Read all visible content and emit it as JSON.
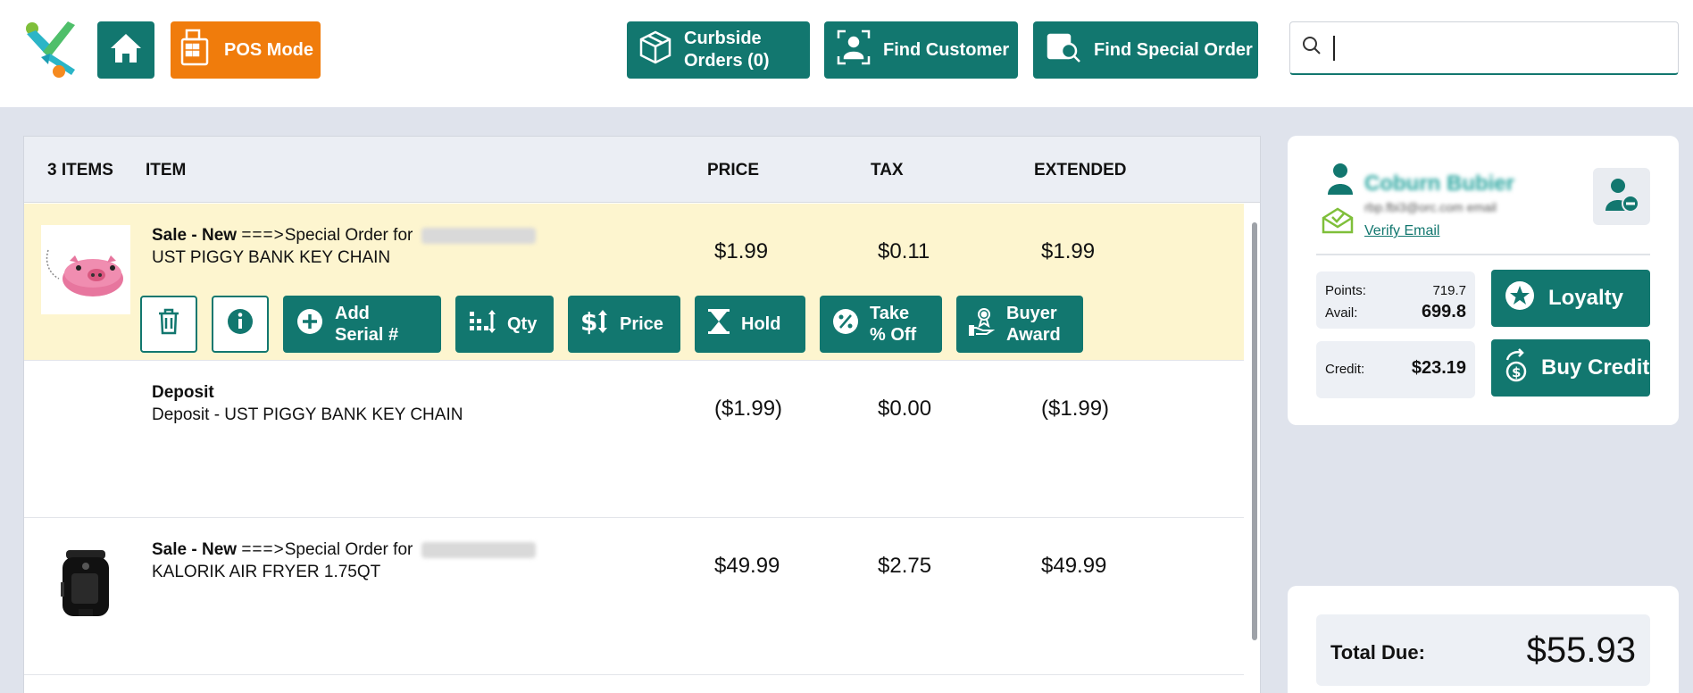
{
  "topbar": {
    "pos_mode_label": "POS Mode",
    "curbside_label_line1": "Curbside",
    "curbside_label_line2": "Orders (0)",
    "find_customer_label": "Find Customer",
    "find_special_order_label": "Find Special Order",
    "search": {
      "value": "",
      "placeholder": ""
    }
  },
  "colors": {
    "accent": "#12776f",
    "pos_orange": "#f07c0c",
    "selected_row": "#fdf5cf"
  },
  "cart": {
    "headers": {
      "count": "3 ITEMS",
      "item": "ITEM",
      "price": "PRICE",
      "tax": "TAX",
      "extended": "EXTENDED"
    },
    "rows": [
      {
        "type_label": "Sale - New",
        "arrow": "===>",
        "special_text": "Special Order for",
        "name": "UST PIGGY BANK KEY CHAIN",
        "price": "$1.99",
        "tax": "$0.11",
        "extended": "$1.99",
        "image": "piggy-bank-keychain"
      },
      {
        "type_label": "Deposit",
        "name": "Deposit - UST PIGGY BANK KEY CHAIN",
        "price": "($1.99)",
        "tax": "$0.00",
        "extended": "($1.99)"
      },
      {
        "type_label": "Sale - New",
        "arrow": "===>",
        "special_text": "Special Order for",
        "name": "KALORIK AIR FRYER 1.75QT",
        "price": "$49.99",
        "tax": "$2.75",
        "extended": "$49.99",
        "image": "air-fryer"
      }
    ],
    "actions": {
      "add_serial_1": "Add",
      "add_serial_2": "Serial #",
      "qty": "Qty",
      "price": "Price",
      "hold": "Hold",
      "take_off_1": "Take",
      "take_off_2": "% Off",
      "buyer_award_1": "Buyer",
      "buyer_award_2": "Award"
    }
  },
  "customer": {
    "name": "Coburn Bubier",
    "email": "rbp.fbi3@orc.com email",
    "verify_email": "Verify Email",
    "points_label": "Points:",
    "points_value": "719.7",
    "avail_label": "Avail:",
    "avail_value": "699.8",
    "credit_label": "Credit:",
    "credit_value": "$23.19",
    "loyalty_label": "Loyalty",
    "buy_credit_label": "Buy Credit"
  },
  "totals": {
    "label": "Total Due:",
    "value": "$55.93"
  }
}
